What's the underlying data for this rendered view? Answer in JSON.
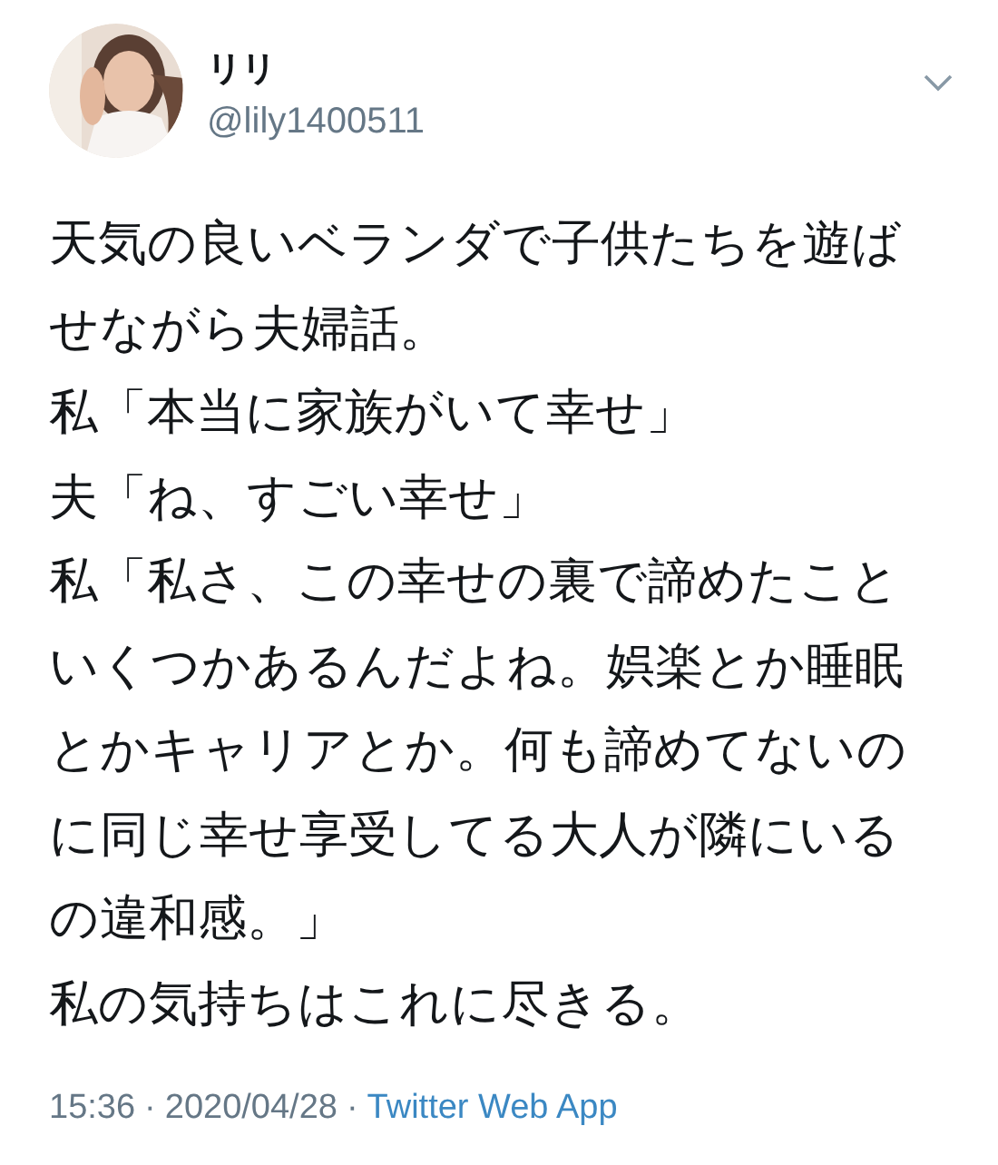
{
  "author": {
    "name": "リリ",
    "handle": "@lily1400511"
  },
  "body": [
    "天気の良いベランダで子供たちを遊ばせながら夫婦話。",
    "私「本当に家族がいて幸せ」",
    "夫「ね、すごい幸せ」",
    "私「私さ、この幸せの裏で諦めたこといくつかあるんだよね。娯楽とか睡眠とかキャリアとか。何も諦めてないのに同じ幸せ享受してる大人が隣にいるの違和感。」",
    "私の気持ちはこれに尽きる。"
  ],
  "meta": {
    "time": "15:36",
    "separator_1": "·",
    "date": "2020/04/28",
    "separator_2": "·",
    "source": "Twitter Web App"
  }
}
